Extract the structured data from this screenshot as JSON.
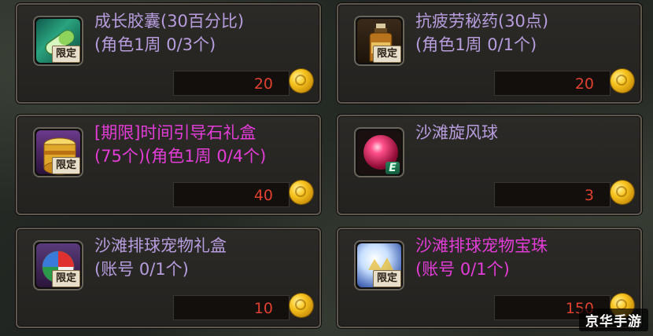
{
  "badge_label": "限定",
  "colors": {
    "purple_name": "#b79dde",
    "magenta_name": "#e43cd8",
    "price": "#e0402e"
  },
  "items": [
    {
      "line1": "成长胶囊(30百分比)",
      "line2": "(角色1周 0/3个)",
      "price": "20",
      "badge": true,
      "name_color": "#b79dde",
      "icon": "capsule-icon"
    },
    {
      "line1": "抗疲劳秘药(30点)",
      "line2": "(角色1周 0/1个)",
      "price": "20",
      "badge": true,
      "name_color": "#b79dde",
      "icon": "potion-bottle-icon"
    },
    {
      "line1": "[期限]时间引导石礼盒",
      "line2": "(75个)(角色1周 0/4个)",
      "price": "40",
      "badge": true,
      "name_color": "#e43cd8",
      "icon": "gold-box-icon"
    },
    {
      "line1": "沙滩旋风球",
      "line2": "",
      "price": "3",
      "badge": false,
      "name_color": "#b79dde",
      "icon": "pink-ball-icon",
      "e_badge": "E"
    },
    {
      "line1": "沙滩排球宠物礼盒",
      "line2": "(账号 0/1个)",
      "price": "10",
      "badge": true,
      "name_color": "#b79dde",
      "icon": "beach-ball-icon"
    },
    {
      "line1": "沙滩排球宠物宝珠",
      "line2": "(账号 0/1个)",
      "price": "150",
      "badge": true,
      "name_color": "#e43cd8",
      "icon": "pet-orb-icon"
    }
  ],
  "watermark": "京华手游"
}
